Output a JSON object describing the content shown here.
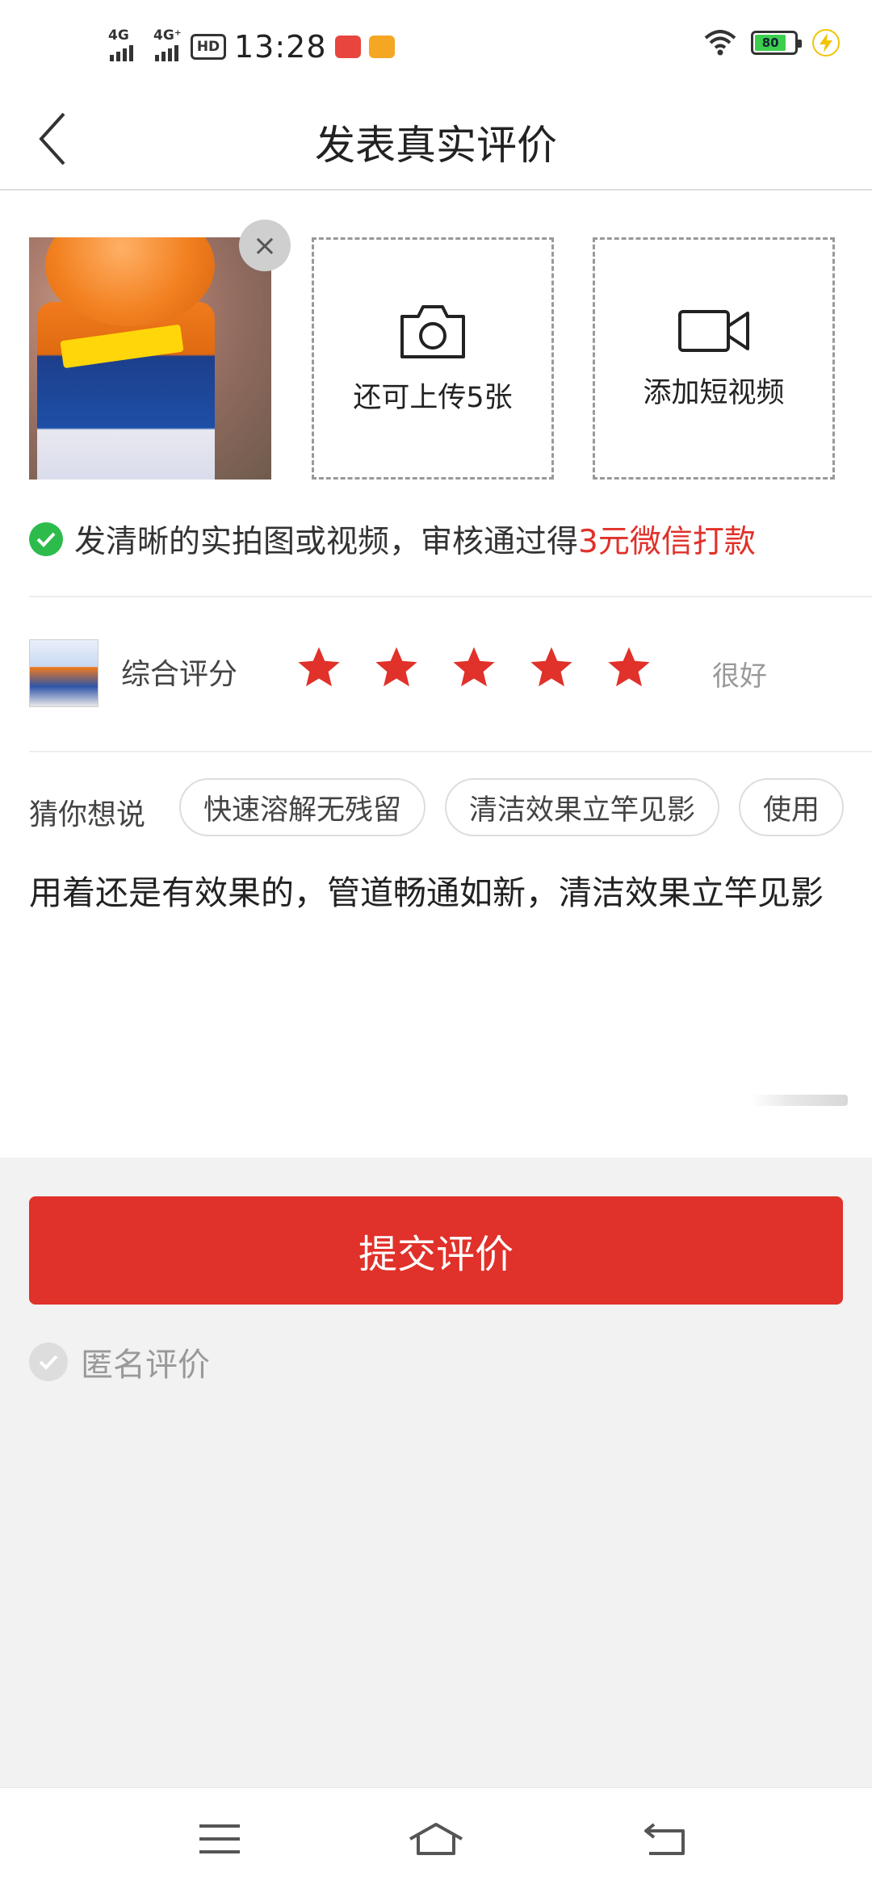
{
  "status_bar": {
    "network_1": "4G",
    "network_2": "4G⁺",
    "hd_badge": "HD",
    "time": "13:28",
    "battery_level": "80",
    "battery_color": "#3ccf4e"
  },
  "header": {
    "back_icon": "chevron-left-icon",
    "title": "发表真实评价"
  },
  "media": {
    "remove_icon": "close-icon",
    "remove_symbol": "×",
    "upload_photo_label": "还可上传5张",
    "upload_video_label": "添加短视频"
  },
  "tip": {
    "text": "发清晰的实拍图或视频，审核通过得",
    "highlight": "3元微信打款",
    "accent_color": "#e0312a"
  },
  "rating": {
    "label": "综合评分",
    "stars": 5,
    "max_stars": 5,
    "value_text": "很好",
    "star_color": "#e0312a"
  },
  "suggestions": {
    "label": "猜你想说",
    "chips": [
      "快速溶解无残留",
      "清洁效果立竿见影",
      "使用"
    ]
  },
  "review": {
    "text": "用着还是有效果的，管道畅通如新，清洁效果立竿见影"
  },
  "actions": {
    "submit_label": "提交评价",
    "anonymous_label": "匿名评价",
    "anonymous_checked": false
  },
  "nav": {
    "menu_icon": "menu-icon",
    "home_icon": "home-icon",
    "back_icon": "return-icon"
  }
}
